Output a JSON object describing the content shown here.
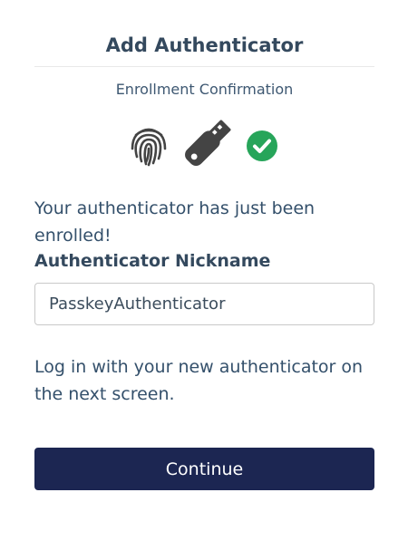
{
  "header": {
    "title": "Add Authenticator",
    "subtitle": "Enrollment Confirmation"
  },
  "icons": {
    "fingerprint": "fingerprint-icon",
    "security_key": "usb-security-key-icon",
    "check": "check-circle-icon"
  },
  "colors": {
    "heading": "#34495e",
    "button_bg": "#1c2652",
    "check_green": "#27a55a",
    "icon_gray": "#444444"
  },
  "main": {
    "message": "Your authenticator has just been enrolled!",
    "nickname_label": "Authenticator Nickname",
    "nickname_value": "PasskeyAuthenticator",
    "instructions": "Log in with your new authenticator on the next screen.",
    "continue_label": "Continue"
  }
}
